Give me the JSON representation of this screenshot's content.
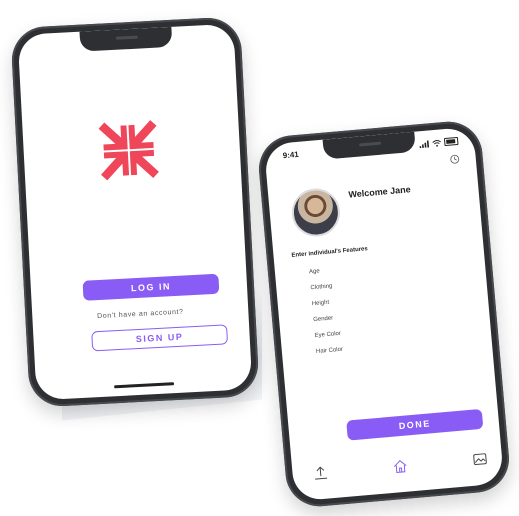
{
  "login_screen": {
    "login_label": "LOG IN",
    "no_account_text": "Don't have an account?",
    "signup_label": "SIGN UP"
  },
  "features_screen": {
    "status_time": "9:41",
    "welcome_text": "Welcome Jane",
    "features_title": "Enter individual's Features",
    "features": [
      "Age",
      "Clothing",
      "Height",
      "Gender",
      "Eye Color",
      "Hair Color"
    ],
    "done_label": "DONE",
    "tabs": [
      "upload-icon",
      "home-icon",
      "gallery-icon"
    ]
  },
  "colors": {
    "accent": "#8a5cf6",
    "logo": "#f0465a",
    "frame": "#2e2f33"
  }
}
